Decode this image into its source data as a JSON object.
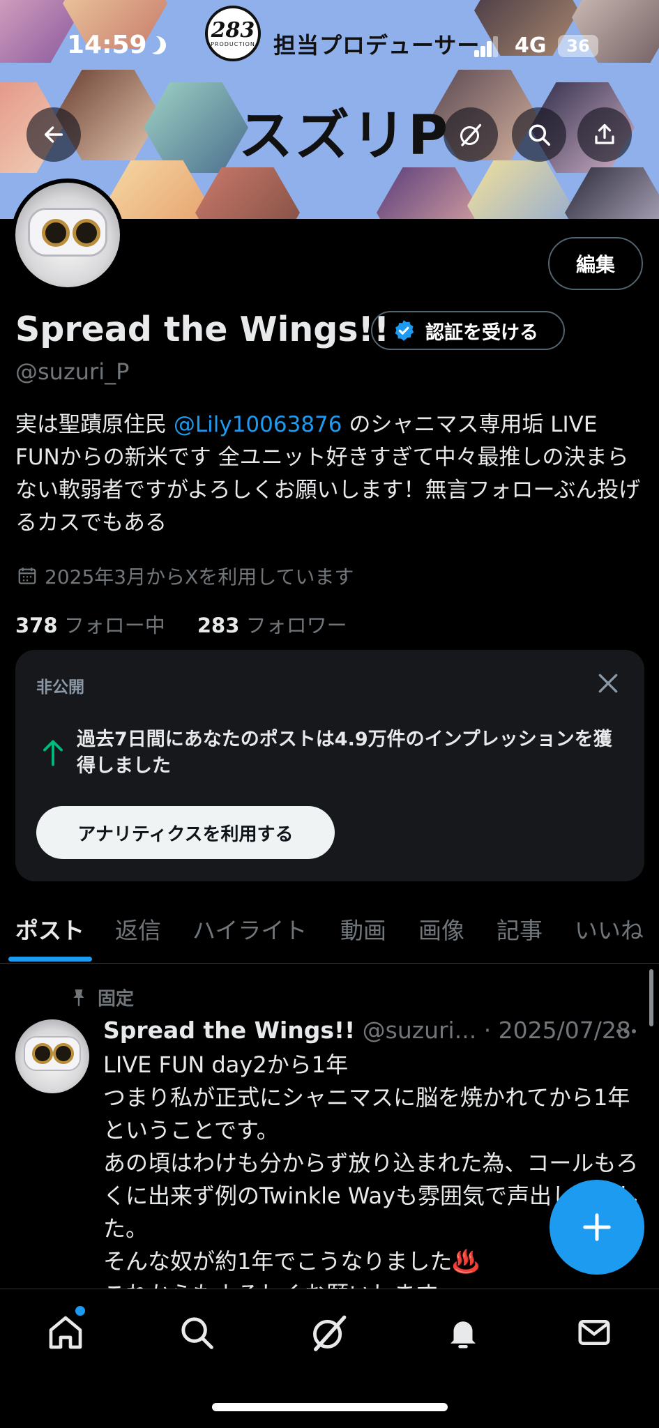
{
  "status_bar": {
    "time": "14:59",
    "network": "4G",
    "battery": "36"
  },
  "banner": {
    "logo_number": "283",
    "logo_sub": "PRODUCTION",
    "role_text": "担当プロデューサー",
    "name_text": "スズリP"
  },
  "header": {
    "back_icon": "back-arrow-icon",
    "grok_icon": "grok-icon",
    "search_icon": "search-icon",
    "share_icon": "share-icon"
  },
  "profile": {
    "edit_label": "編集",
    "display_name": "Spread the Wings!!",
    "verify_label": "認証を受ける",
    "handle": "@suzuri_P",
    "bio_before": "実は聖蹟原住民 ",
    "bio_mention": "@Lily10063876",
    "bio_after": " のシャニマス専用垢 LIVE FUNからの新米です 全ユニット好きすぎて中々最推しの決まらない軟弱者ですがよろしくお願いします！無言フォローぶん投げるカスでもある",
    "joined": "2025年3月からXを利用しています",
    "following_count": "378",
    "following_label": "フォロー中",
    "followers_count": "283",
    "followers_label": "フォロワー"
  },
  "private_card": {
    "label": "非公開",
    "message": "過去7日間にあなたのポストは4.9万件のインプレッションを獲得しました",
    "button_label": "アナリティクスを利用する"
  },
  "tabs": [
    "ポスト",
    "返信",
    "ハイライト",
    "動画",
    "画像",
    "記事",
    "いいね"
  ],
  "pinned_post": {
    "pinned_label": "固定",
    "author": "Spread the Wings!!",
    "handle": "@suzuri...",
    "date": "· 2025/07/28",
    "body": "LIVE FUN day2から1年\nつまり私が正式にシャニマスに脳を焼かれてから1年ということです。\nあの頃はわけも分からず放り込まれた為、コールもろくに出来ず例のTwinkle Wayも雰囲気で声出してました。\nそんな奴が約1年でこうなりました♨️\nこれからもよろしくお願いします"
  },
  "colors": {
    "accent": "#1d9bf0",
    "background": "#000000",
    "secondary_text": "#71767b",
    "card_bg": "#16181c",
    "growth_green": "#00ba7c"
  },
  "bottom_nav": [
    "home-icon",
    "search-icon",
    "grok-icon",
    "bell-icon",
    "mail-icon"
  ]
}
